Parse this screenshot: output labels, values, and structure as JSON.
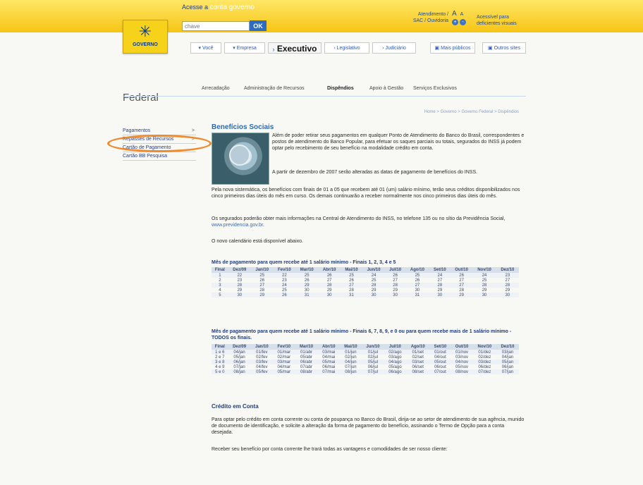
{
  "header": {
    "logo_text": "GOVERNO",
    "access_prefix": "Acesse a",
    "access_link": "conta governo",
    "search_placeholder": "chave",
    "ok_label": "OK",
    "help_line1": "Atendimento /",
    "help_line2": "SAC / Ouvidoria",
    "font_small": "A",
    "font_big": "A",
    "font_plus": "+",
    "font_minus": "-",
    "accessible_line1": "Acessível para",
    "accessible_line2": "deficientes visuais"
  },
  "nav": {
    "you": "Você",
    "company": "Empresa",
    "exec": "Executivo",
    "leg": "Legislativo",
    "jud": "Judiciário",
    "more": "Mais públicos",
    "others": "Outros sites"
  },
  "section": {
    "title": "Federal"
  },
  "tabs": [
    "Arrecadação",
    "Administração de Recursos",
    "Dispêndios",
    "Apoio à Gestão",
    "Serviços Exclusivos"
  ],
  "breadcrumb": "Home > Governo > Governo Federal > Dispêndios",
  "sidebar": {
    "items": [
      {
        "label": "Pagamentos",
        "arrow": ">"
      },
      {
        "label": "Repasses de Recursos",
        "arrow": ">"
      },
      {
        "label": "Cartão de Pagamento"
      },
      {
        "label": "Cartão BB Pesquisa"
      }
    ]
  },
  "main": {
    "title": "Benefícios Sociais",
    "p1": "Além de poder retirar seus pagamentos em qualquer Ponto de Atendimento do Banco do Brasil, correspondentes e postos de atendimento do Banco Popular, para efetuar os saques parciais ou totais, segurados do INSS já podem optar pelo recebimento de seu benefício na modalidade crédito em conta.",
    "p2": "A partir de dezembro de 2007 serão alteradas as datas de pagamento de benefícios do INSS.",
    "p3": "Pela nova sistemática, os benefícios com finais de 01 a 05 que recebem até 01 (um) salário mínimo, terão seus créditos disponibilizados nos cinco primeiros dias úteis do mês em curso. Os demais continuarão a receber normalmente nos cinco primeiros dias úteis do mês.",
    "p4_text": "Os segurados poderão obter mais informações na Central de Atendimento do INSS, no telefone 135 ou no sítio da Previdência Social,",
    "p4_link": "www.previdencia.gov.br",
    "p4_end": ".",
    "p5": "O novo calendário está disponível abaixo.",
    "table1_title": "Mês de pagamento para quem recebe até 1 salário mínimo - Finais 1, 2, 3, 4 e 5",
    "table2_title": "Mês de pagamento para quem recebe até 1 salário mínimo - Finais 6, 7, 8, 9, e 0 ou para quem recebe mais de 1 salário mínimo - TODOS os finais.",
    "credit_title": "Crédito em Conta",
    "credit_p1": "Para optar pelo crédito em conta corrente ou conta de poupança no Banco do Brasil, dirija-se ao setor de atendimento de sua agência, munido de documento de identificação, e solicite a alteração da forma de pagamento do benefício, assinando o Termo de Opção para a conta desejada.",
    "credit_p2": "Receber seu benefício por conta corrente lhe trará todas as vantagens e comodidades de ser nosso cliente:"
  },
  "table1": {
    "headers": [
      "Final",
      "Dez/09",
      "Jan/10",
      "Fev/10",
      "Mar/10",
      "Abr/10",
      "Mai/10",
      "Jun/10",
      "Jul/10",
      "Ago/10",
      "Set/10",
      "Out/10",
      "Nov/10",
      "Dez/10"
    ],
    "rows": [
      [
        "1",
        "22",
        "25",
        "22",
        "25",
        "26",
        "25",
        "24",
        "26",
        "25",
        "24",
        "26",
        "24",
        "23"
      ],
      [
        "2",
        "23",
        "26",
        "23",
        "26",
        "27",
        "26",
        "25",
        "27",
        "26",
        "27",
        "27",
        "25",
        "27"
      ],
      [
        "3",
        "28",
        "27",
        "24",
        "29",
        "28",
        "27",
        "28",
        "28",
        "27",
        "28",
        "27",
        "28",
        "28"
      ],
      [
        "4",
        "29",
        "28",
        "25",
        "30",
        "29",
        "28",
        "29",
        "29",
        "30",
        "29",
        "28",
        "29",
        "29"
      ],
      [
        "5",
        "30",
        "29",
        "26",
        "31",
        "30",
        "31",
        "30",
        "30",
        "31",
        "30",
        "29",
        "30",
        "30"
      ]
    ]
  },
  "table2": {
    "headers": [
      "Final",
      "Dez/09",
      "Jan/10",
      "Fev/10",
      "Mar/10",
      "Abr/10",
      "Mai/10",
      "Jun/10",
      "Jul/10",
      "Ago/10",
      "Set/10",
      "Out/10",
      "Nov/10",
      "Dez/10"
    ],
    "rows": [
      [
        "1 e 6",
        "04/jan",
        "01/fev",
        "01/mar",
        "01/abr",
        "03/mai",
        "01/jun",
        "01/jul",
        "02/ago",
        "01/set",
        "01/out",
        "01/nov",
        "01/dez",
        "03/jan"
      ],
      [
        "2 e 7",
        "05/jan",
        "02/fev",
        "02/mar",
        "05/abr",
        "04/mai",
        "02/jun",
        "02/jul",
        "03/ago",
        "02/set",
        "04/out",
        "03/nov",
        "02/dez",
        "04/jan"
      ],
      [
        "3 e 8",
        "06/jan",
        "03/fev",
        "03/mar",
        "06/abr",
        "05/mai",
        "04/jun",
        "05/jul",
        "04/ago",
        "03/set",
        "05/out",
        "04/nov",
        "03/dez",
        "05/jan"
      ],
      [
        "4 e 9",
        "07/jan",
        "04/fev",
        "04/mar",
        "07/abr",
        "06/mai",
        "07/jun",
        "06/jul",
        "05/ago",
        "06/set",
        "06/out",
        "05/nov",
        "06/dez",
        "06/jan"
      ],
      [
        "5 e 0",
        "08/jan",
        "05/fev",
        "05/mar",
        "08/abr",
        "07/mai",
        "08/jun",
        "07/jul",
        "06/ago",
        "08/set",
        "07/out",
        "08/nov",
        "07/dez",
        "07/jan"
      ]
    ]
  }
}
